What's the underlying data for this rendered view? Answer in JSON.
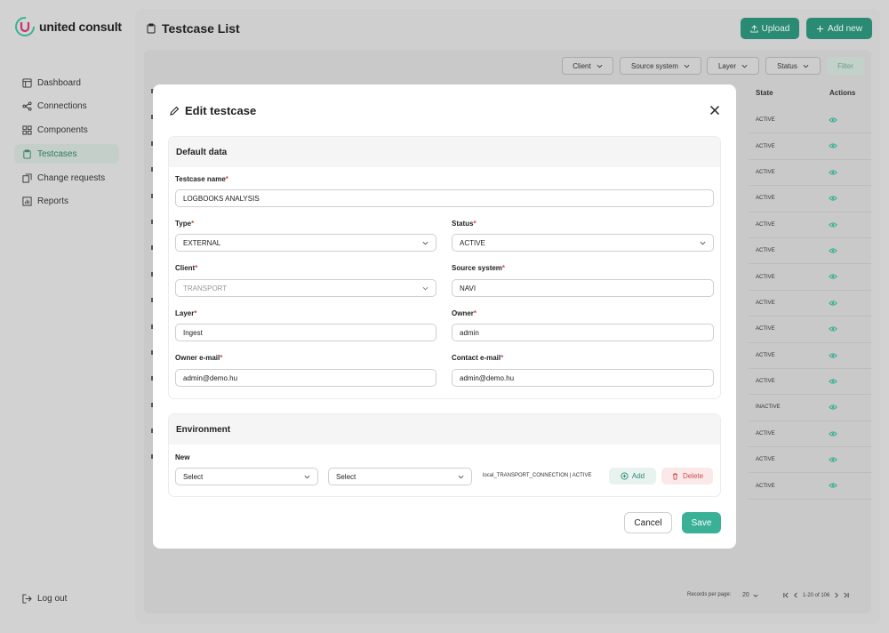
{
  "brand": {
    "name": "united consult"
  },
  "colors": {
    "accent": "#2a8a73",
    "accent_light": "#3ab197",
    "danger": "#d14b4b"
  },
  "sidebar": {
    "items": [
      {
        "label": "Dashboard",
        "icon": "dashboard-icon",
        "active": false
      },
      {
        "label": "Connections",
        "icon": "connections-icon",
        "active": false
      },
      {
        "label": "Components",
        "icon": "components-icon",
        "active": false
      },
      {
        "label": "Testcases",
        "icon": "testcases-icon",
        "active": true
      },
      {
        "label": "Change requests",
        "icon": "change-requests-icon",
        "active": false
      },
      {
        "label": "Reports",
        "icon": "reports-icon",
        "active": false
      }
    ],
    "logout_label": "Log out"
  },
  "page": {
    "title": "Testcase List",
    "upload_label": "Upload",
    "add_new_label": "Add new"
  },
  "filters": {
    "client": "Client",
    "source_system": "Source system",
    "layer": "Layer",
    "status": "Status",
    "filter_button": "Filter"
  },
  "table": {
    "headers": {
      "state": "State",
      "actions": "Actions"
    },
    "states": [
      "ACTIVE",
      "ACTIVE",
      "ACTIVE",
      "ACTIVE",
      "ACTIVE",
      "ACTIVE",
      "ACTIVE",
      "ACTIVE",
      "ACTIVE",
      "ACTIVE",
      "ACTIVE",
      "INACTIVE",
      "ACTIVE",
      "ACTIVE",
      "ACTIVE"
    ]
  },
  "pagination": {
    "records_per_page_label": "Records per page:",
    "records_per_page": "20",
    "range": "1-20 of 106"
  },
  "modal": {
    "title": "Edit testcase",
    "default_section": "Default data",
    "fields": {
      "testcase_name": {
        "label": "Testcase name",
        "value": "LOGBOOKS ANALYSIS"
      },
      "type": {
        "label": "Type",
        "value": "EXTERNAL"
      },
      "status": {
        "label": "Status",
        "value": "ACTIVE"
      },
      "client": {
        "label": "Client",
        "value": "TRANSPORT"
      },
      "source_system": {
        "label": "Source system",
        "value": "NAVI"
      },
      "layer": {
        "label": "Layer",
        "value": "Ingest"
      },
      "owner": {
        "label": "Owner",
        "value": "admin"
      },
      "owner_email": {
        "label": "Owner e-mail",
        "value": "admin@demo.hu"
      },
      "contact_email": {
        "label": "Contact e-mail",
        "value": "admin@demo.hu"
      }
    },
    "required_mark": "*",
    "environment_section": "Environment",
    "env_new_label": "New",
    "env_select_1": "Select",
    "env_select_2": "Select",
    "env_connection": "local_TRANSPORT_CONNECTION | ACTIVE",
    "env_add_label": "Add",
    "env_delete_label": "Delete",
    "cancel_label": "Cancel",
    "save_label": "Save"
  }
}
